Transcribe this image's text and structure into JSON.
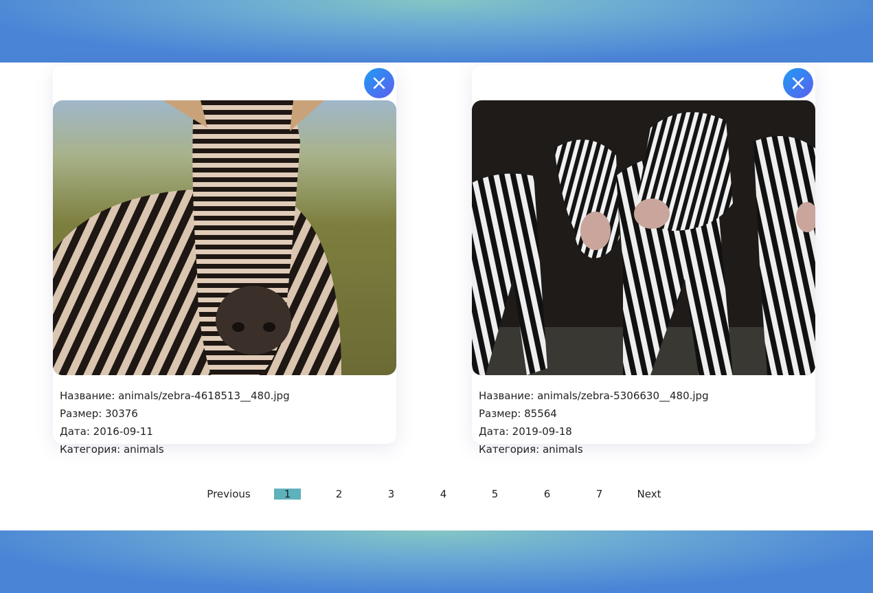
{
  "colors": {
    "band_gradient": [
      "#85c6c4",
      "#4a84d6"
    ],
    "close_button": [
      "#1f9cf2",
      "#5b5ef0"
    ],
    "active_page": "#5fb1bb"
  },
  "cards": [
    {
      "image_icon": "zebra-closeup-photo",
      "name_label": "Название: animals/zebra-4618513__480.jpg",
      "size_label": "Размер: 30376",
      "date_label": "Дата: 2016-09-11",
      "category_label": "Категория: animals"
    },
    {
      "image_icon": "zebra-herd-photo",
      "name_label": "Название: animals/zebra-5306630__480.jpg",
      "size_label": "Размер: 85564",
      "date_label": "Дата: 2019-09-18",
      "category_label": "Категория: animals"
    }
  ],
  "pagination": {
    "previous": "Previous",
    "pages": [
      "1",
      "2",
      "3",
      "4",
      "5",
      "6",
      "7"
    ],
    "current_page": "1",
    "next": "Next"
  }
}
